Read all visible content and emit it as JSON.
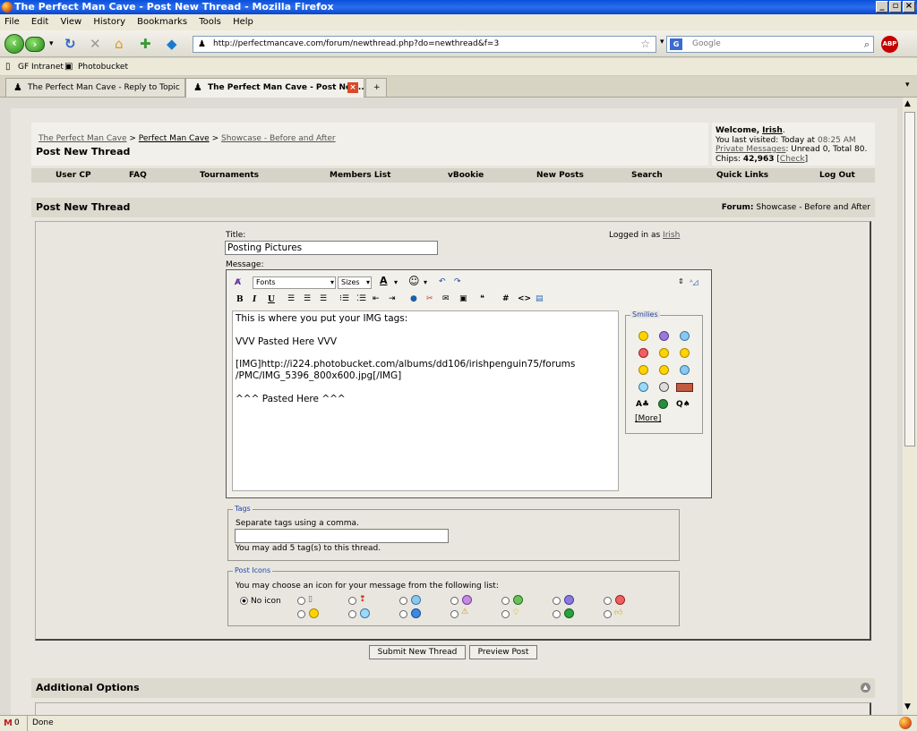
{
  "window": {
    "title": "The Perfect Man Cave - Post New Thread - Mozilla Firefox"
  },
  "menu": [
    "File",
    "Edit",
    "View",
    "History",
    "Bookmarks",
    "Tools",
    "Help"
  ],
  "browser": {
    "url": "http://perfectmancave.com/forum/newthread.php?do=newthread&f=3",
    "search_placeholder": "Google",
    "bookmarks": [
      "GF Intranet",
      "Photobucket"
    ],
    "tabs": [
      {
        "label": "The Perfect Man Cave - Reply to Topic"
      },
      {
        "label": "The Perfect Man Cave - Post New..."
      }
    ],
    "status": "Done"
  },
  "forum": {
    "breadcrumb": [
      "The Perfect Man Cave",
      "Perfect Man Cave",
      "Showcase - Before and After"
    ],
    "breadcrumb_sep": ">",
    "page_title": "Post New Thread",
    "welcome": {
      "prefix": "Welcome,",
      "user": "Irish",
      "last_visited_label": "You last visited: Today at",
      "last_visited_time": "08:25 AM",
      "pm_label": "Private Messages",
      "pm_counts": ": Unread 0, Total 80.",
      "chips_label": "Chips:",
      "chips_value": "42,963",
      "check_link": "Check"
    },
    "nav": [
      "User CP",
      "FAQ",
      "Tournaments",
      "Members List",
      "vBookie",
      "New Posts",
      "Search",
      "Quick Links",
      "Log Out"
    ],
    "section_title": "Post New Thread",
    "forum_label": "Forum:",
    "forum_name": "Showcase - Before and After",
    "form": {
      "title_label": "Title:",
      "title_value": "Posting Pictures",
      "logged_in_label": "Logged in as",
      "logged_in_user": "Irish",
      "message_label": "Message:",
      "fonts_label": "Fonts",
      "sizes_label": "Sizes",
      "message_value": "This is where you put your IMG tags:\n\nVVV Pasted Here VVV\n\n[IMG]http://i224.photobucket.com/albums/dd106/irishpenguin75/forums\n/PMC/IMG_5396_800x600.jpg[/IMG]\n\n^^^ Pasted Here ^^^",
      "smilies_legend": "Smilies",
      "more_link": "[More]",
      "tags_legend": "Tags",
      "tags_help": "Separate tags using a comma.",
      "tags_value": "",
      "tags_limit": "You may add 5 tag(s) to this thread.",
      "post_icons_legend": "Post Icons",
      "post_icons_help": "You may choose an icon for your message from the following list:",
      "no_icon_label": "No icon",
      "submit_label": "Submit New Thread",
      "preview_label": "Preview Post"
    },
    "additional_options_title": "Additional Options"
  },
  "colors": {
    "title_bar": "#0a4fd8",
    "smiley": "#ffd400",
    "link": "#555555"
  }
}
